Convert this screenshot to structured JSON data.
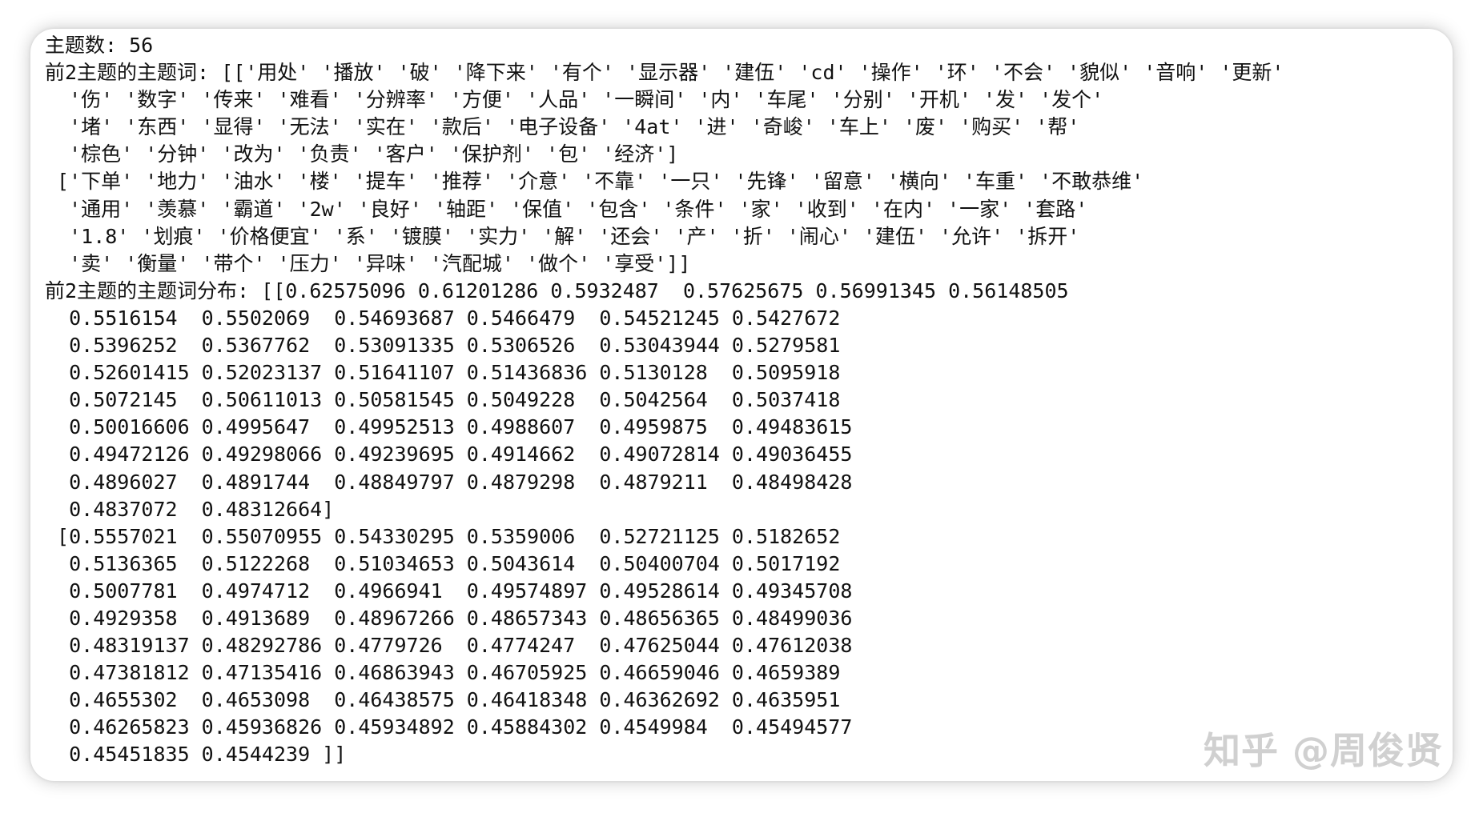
{
  "output_lines": [
    "主题数: 56",
    "前2主题的主题词: [['用处' '播放' '破' '降下来' '有个' '显示器' '建伍' 'cd' '操作' '环' '不会' '貌似' '音响' '更新'",
    "  '伤' '数字' '传来' '难看' '分辨率' '方便' '人品' '一瞬间' '内' '车尾' '分别' '开机' '发' '发个'",
    "  '堵' '东西' '显得' '无法' '实在' '款后' '电子设备' '4at' '进' '奇峻' '车上' '废' '购买' '帮'",
    "  '棕色' '分钟' '改为' '负责' '客户' '保护剂' '包' '经济']",
    " ['下单' '地力' '油水' '楼' '提车' '推荐' '介意' '不靠' '一只' '先锋' '留意' '横向' '车重' '不敢恭维'",
    "  '通用' '羡慕' '霸道' '2w' '良好' '轴距' '保值' '包含' '条件' '家' '收到' '在内' '一家' '套路'",
    "  '1.8' '划痕' '价格便宜' '系' '镀膜' '实力' '解' '还会' '产' '折' '闹心' '建伍' '允许' '拆开'",
    "  '卖' '衡量' '带个' '压力' '异味' '汽配城' '做个' '享受']]",
    "前2主题的主题词分布: [[0.62575096 0.61201286 0.5932487  0.57625675 0.56991345 0.56148505",
    "  0.5516154  0.5502069  0.54693687 0.5466479  0.54521245 0.5427672",
    "  0.5396252  0.5367762  0.53091335 0.5306526  0.53043944 0.5279581",
    "  0.52601415 0.52023137 0.51641107 0.51436836 0.5130128  0.5095918",
    "  0.5072145  0.50611013 0.50581545 0.5049228  0.5042564  0.5037418",
    "  0.50016606 0.4995647  0.49952513 0.4988607  0.4959875  0.49483615",
    "  0.49472126 0.49298066 0.49239695 0.4914662  0.49072814 0.49036455",
    "  0.4896027  0.4891744  0.48849797 0.4879298  0.4879211  0.48498428",
    "  0.4837072  0.48312664]",
    " [0.5557021  0.55070955 0.54330295 0.5359006  0.52721125 0.5182652",
    "  0.5136365  0.5122268  0.51034653 0.5043614  0.50400704 0.5017192",
    "  0.5007781  0.4974712  0.4966941  0.49574897 0.49528614 0.49345708",
    "  0.4929358  0.4913689  0.48967266 0.48657343 0.48656365 0.48499036",
    "  0.48319137 0.48292786 0.4779726  0.4774247  0.47625044 0.47612038",
    "  0.47381812 0.47135416 0.46863943 0.46705925 0.46659046 0.4659389",
    "  0.4655302  0.4653098  0.46438575 0.46418348 0.46362692 0.4635951",
    "  0.46265823 0.45936826 0.45934892 0.45884302 0.4549984  0.45494577",
    "  0.45451835 0.4544239 ]]"
  ],
  "watermark": {
    "text": "知乎 @周俊贤"
  }
}
